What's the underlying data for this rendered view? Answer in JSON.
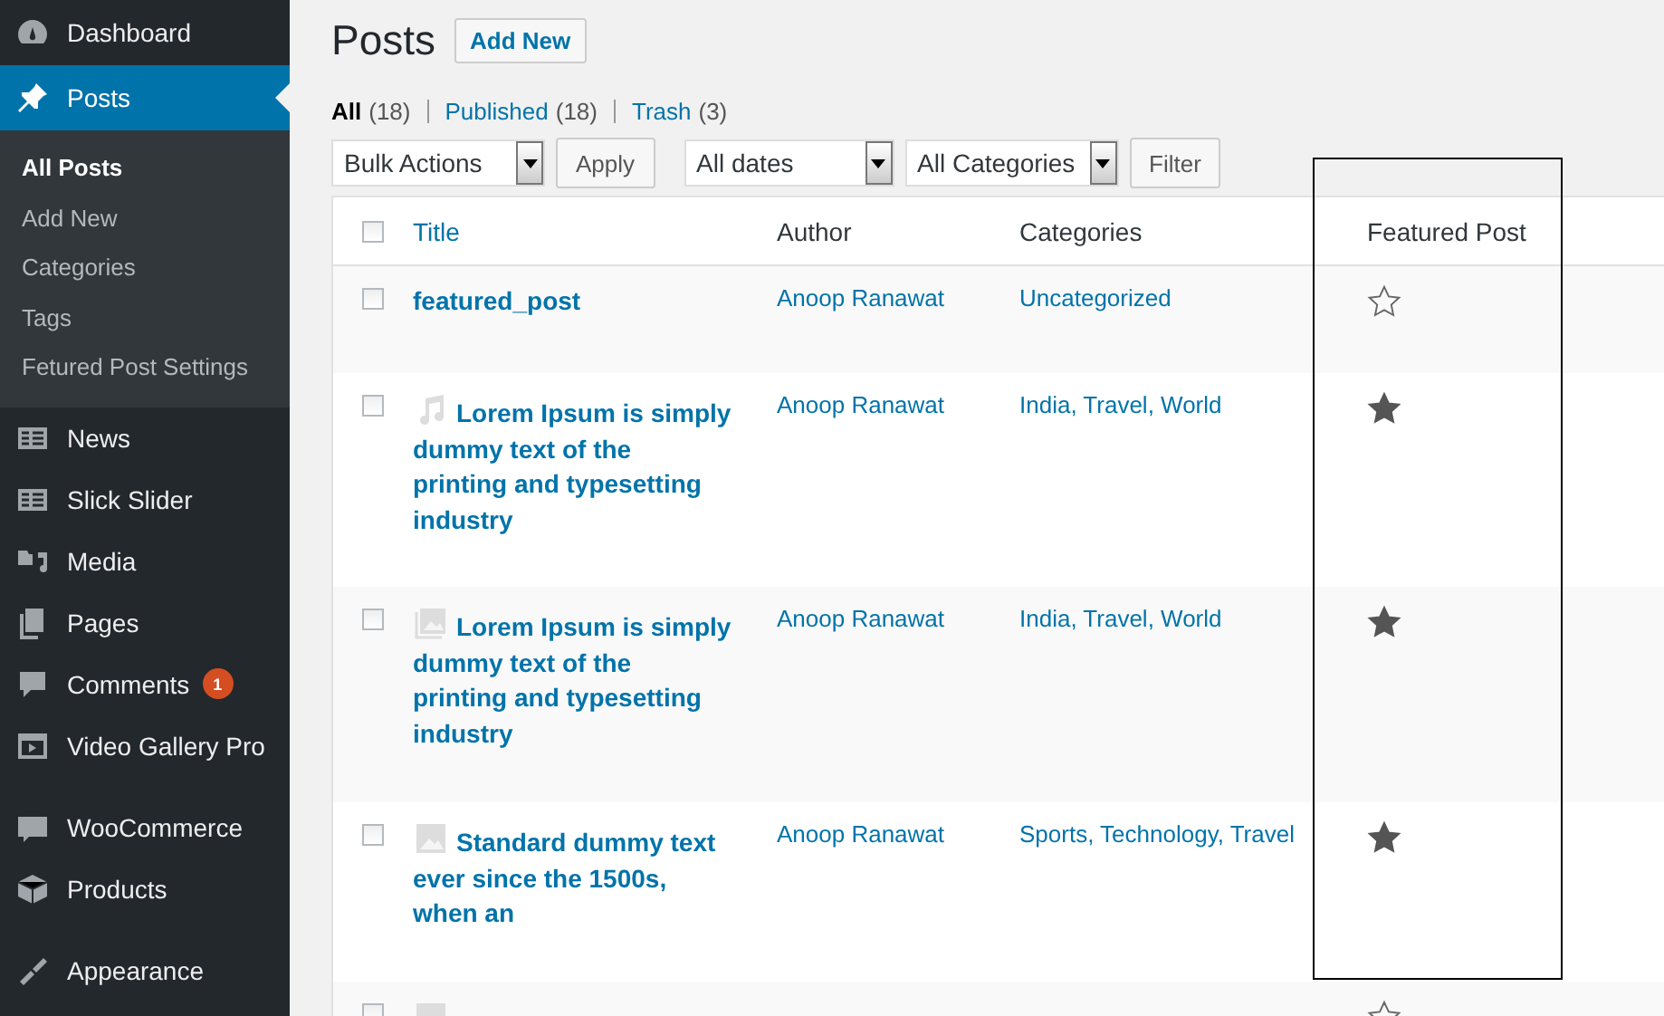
{
  "sidebar": {
    "groups": [
      [
        {
          "label": "Dashboard",
          "selected": false
        },
        {
          "label": "Posts",
          "selected": true,
          "children": [
            {
              "label": "All Posts",
              "selected": true
            },
            {
              "label": "Add New",
              "selected": false
            },
            {
              "label": "Categories",
              "selected": false
            },
            {
              "label": "Tags",
              "selected": false
            },
            {
              "label": "Fetured Post Settings",
              "selected": false
            }
          ]
        },
        {
          "label": "News",
          "selected": false
        },
        {
          "label": "Slick Slider",
          "selected": false
        },
        {
          "label": "Media",
          "selected": false
        },
        {
          "label": "Pages",
          "selected": false
        },
        {
          "label": "Comments",
          "selected": false,
          "badge": "1"
        },
        {
          "label": "Video Gallery Pro",
          "selected": false
        }
      ],
      [
        {
          "label": "WooCommerce",
          "selected": false
        },
        {
          "label": "Products",
          "selected": false
        }
      ],
      [
        {
          "label": "Appearance",
          "selected": false
        }
      ]
    ]
  },
  "page": {
    "title": "Posts",
    "add_button": "Add New"
  },
  "views": [
    {
      "label": "All",
      "count": "(18)",
      "selected": true
    },
    {
      "label": "Published",
      "count": "(18)",
      "selected": false
    },
    {
      "label": "Trash",
      "count": "(3)",
      "selected": false
    }
  ],
  "toolbar": {
    "bulk_select": "Bulk Actions",
    "apply": "Apply",
    "date_select": "All dates",
    "category_select": "All Categories",
    "filter": "Filter"
  },
  "table": {
    "select_all_checked": false,
    "columns": [
      "Title",
      "Author",
      "Categories",
      "Featured Post"
    ],
    "rows": [
      {
        "checked": false,
        "kind": "standard",
        "title": "featured_post",
        "author": "Anoop Ranawat",
        "categories": "Uncategorized",
        "featured": false
      },
      {
        "checked": false,
        "kind": "audio",
        "title": "Lorem Ipsum is simply dummy text of the printing and typesetting industry",
        "author": "Anoop Ranawat",
        "categories": "India, Travel, World",
        "featured": true
      },
      {
        "checked": false,
        "kind": "gallery",
        "title": "Lorem Ipsum is simply dummy text of the printing and typesetting industry",
        "author": "Anoop Ranawat",
        "categories": "India, Travel, World",
        "featured": true
      },
      {
        "checked": false,
        "kind": "image",
        "title": "Standard dummy text ever since the 1500s, when an",
        "author": "Anoop Ranawat",
        "categories": "Sports, Technology, Travel",
        "featured": true
      },
      {
        "checked": false,
        "kind": "image",
        "featured": false
      }
    ]
  }
}
